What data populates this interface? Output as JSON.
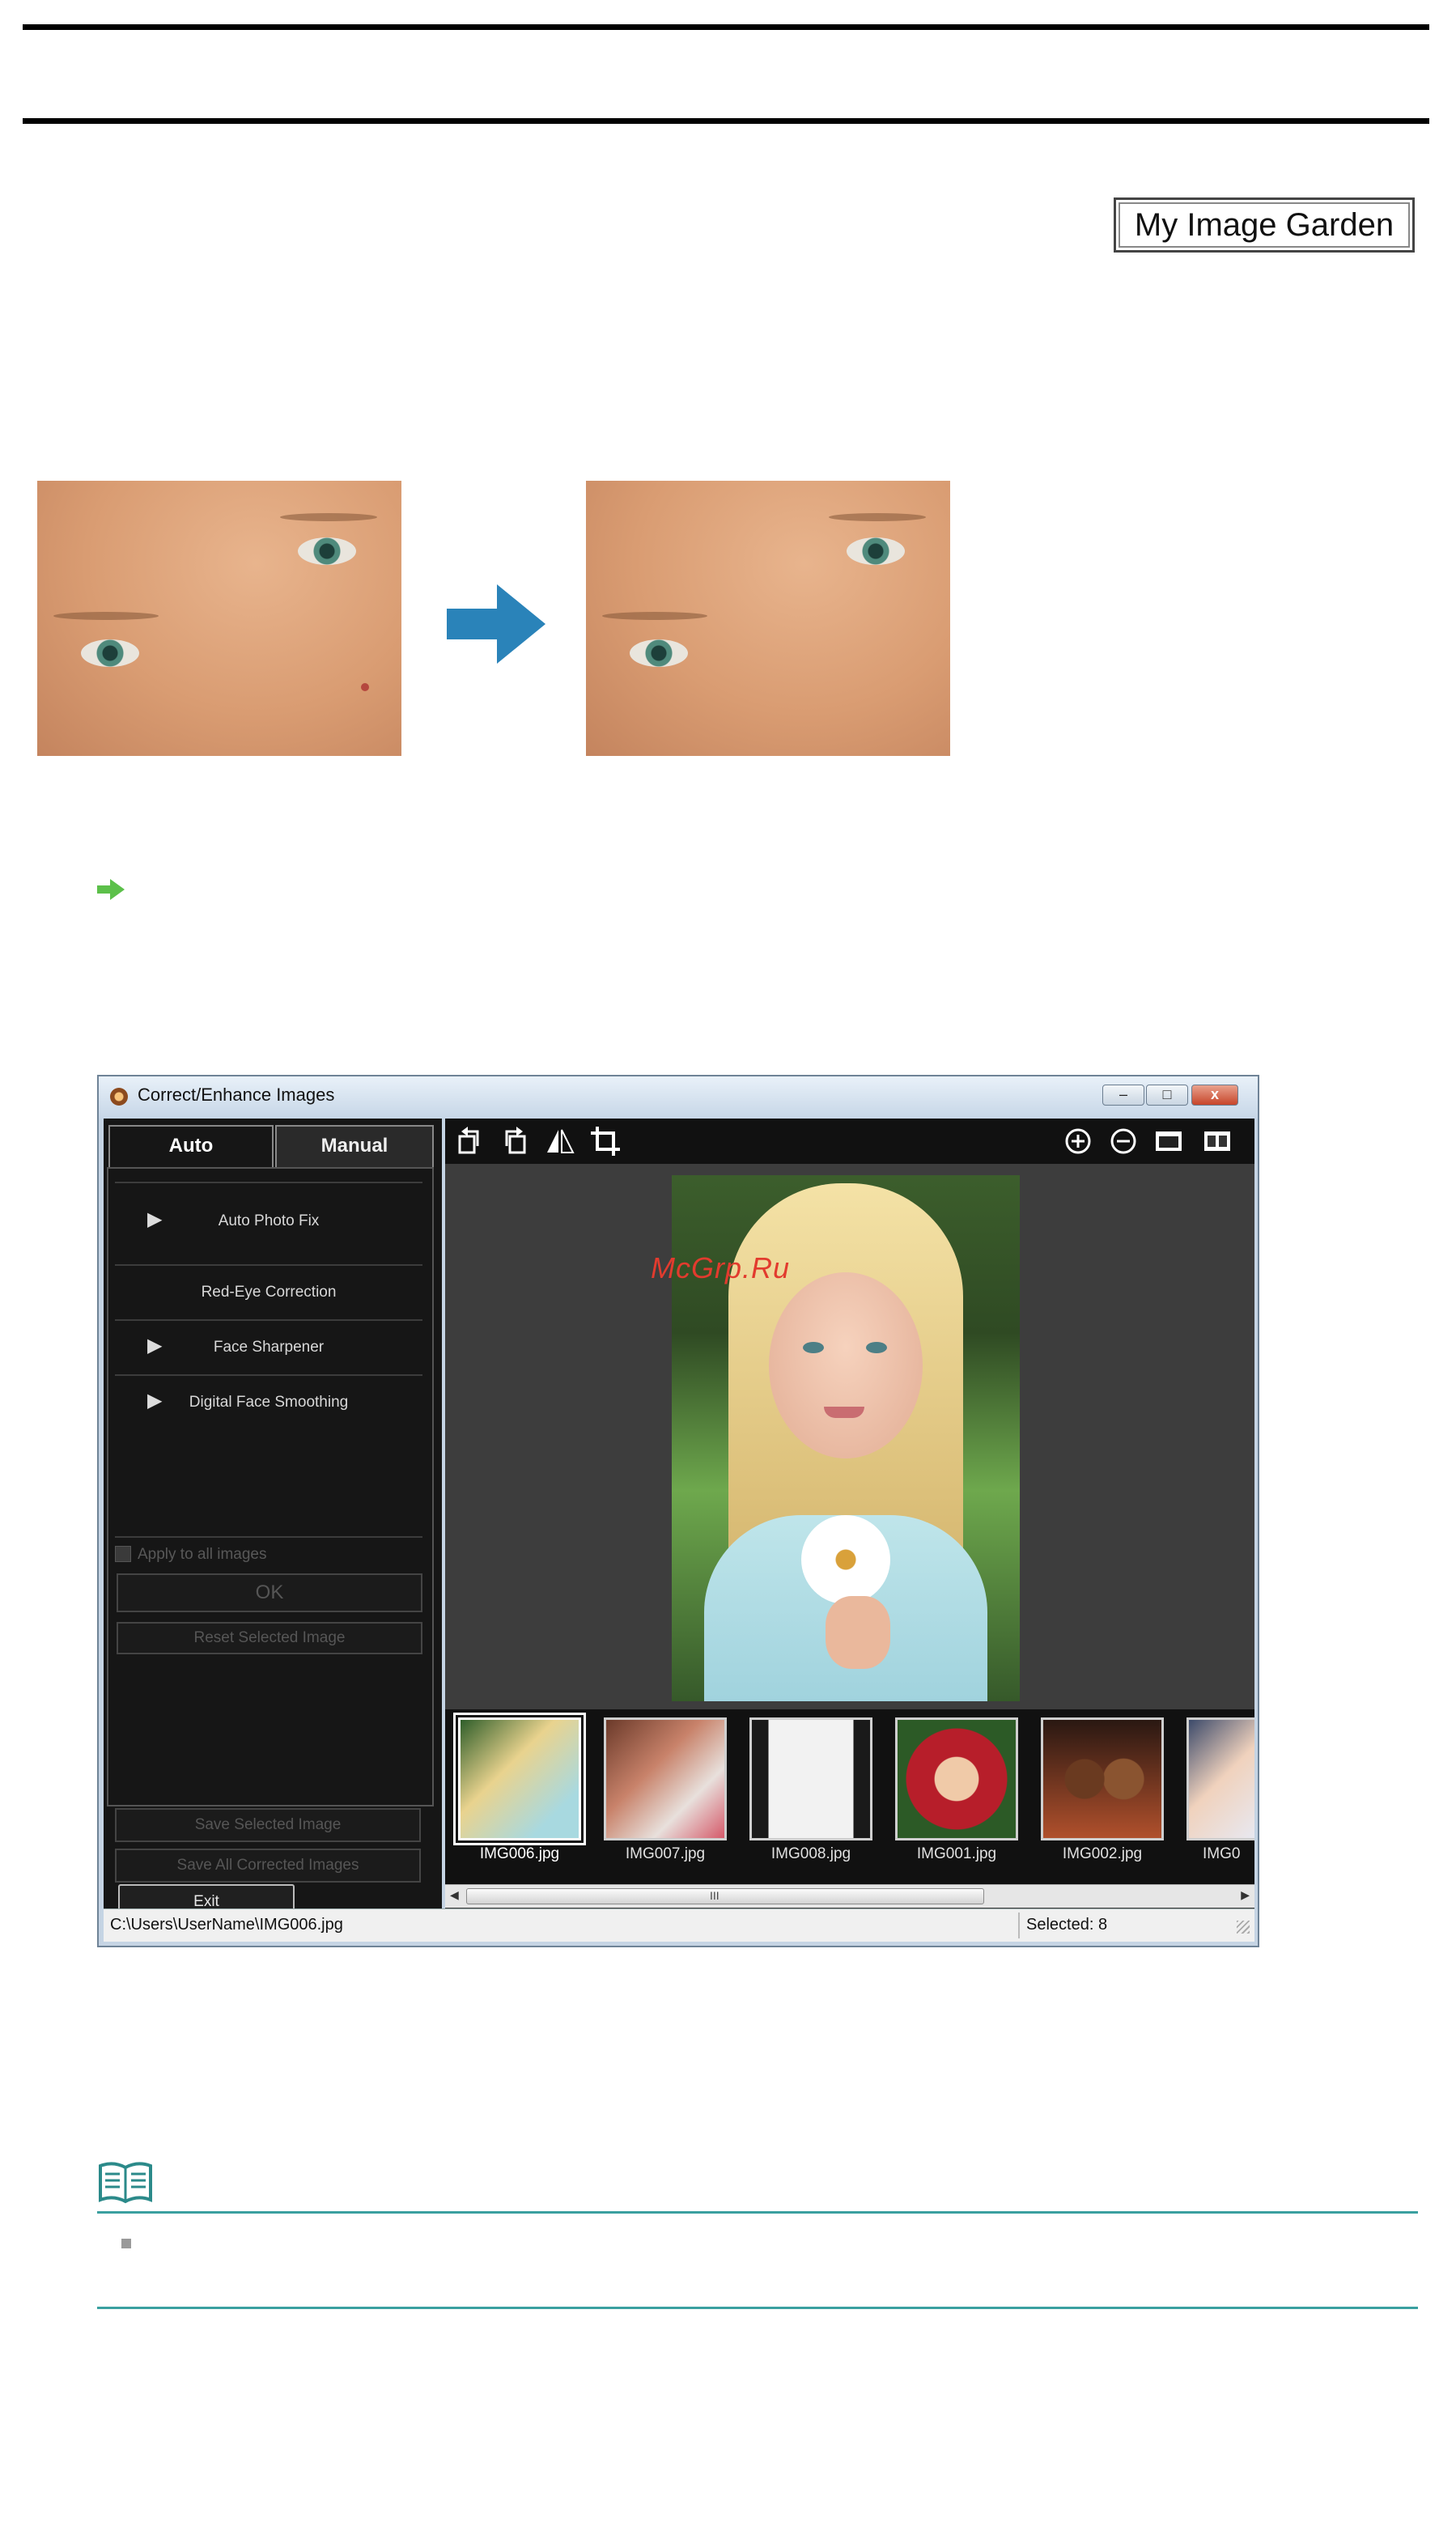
{
  "header": {
    "badge_label": "My Image Garden"
  },
  "illustration": {
    "arrow_color": "#2a83b9"
  },
  "window": {
    "title": "Correct/Enhance Images",
    "controls": {
      "minimize": "–",
      "restore": "□",
      "close": "x"
    },
    "tabs": [
      {
        "label": "Auto"
      },
      {
        "label": "Manual"
      }
    ],
    "corrections": [
      {
        "label": "Auto Photo Fix"
      },
      {
        "label": "Red-Eye Correction"
      },
      {
        "label": "Face Sharpener"
      },
      {
        "label": "Digital Face Smoothing"
      }
    ],
    "apply_all_label": "Apply to all images",
    "ok_label": "OK",
    "reset_label": "Reset Selected Image",
    "save_selected_label": "Save Selected Image",
    "save_all_label": "Save All Corrected Images",
    "exit_label": "Exit",
    "thumbnails": [
      {
        "label": "IMG006.jpg"
      },
      {
        "label": "IMG007.jpg"
      },
      {
        "label": "IMG008.jpg"
      },
      {
        "label": "IMG001.jpg"
      },
      {
        "label": "IMG002.jpg"
      },
      {
        "label": "IMG0"
      }
    ],
    "scrollbar_grip": "III",
    "status_path": "C:\\Users\\UserName\\IMG006.jpg",
    "status_selected": "Selected: 8"
  },
  "watermark": "McGrp.Ru",
  "colors": {
    "note_rule": "#3aa0a0",
    "link_arrow": "#5cc04a"
  }
}
